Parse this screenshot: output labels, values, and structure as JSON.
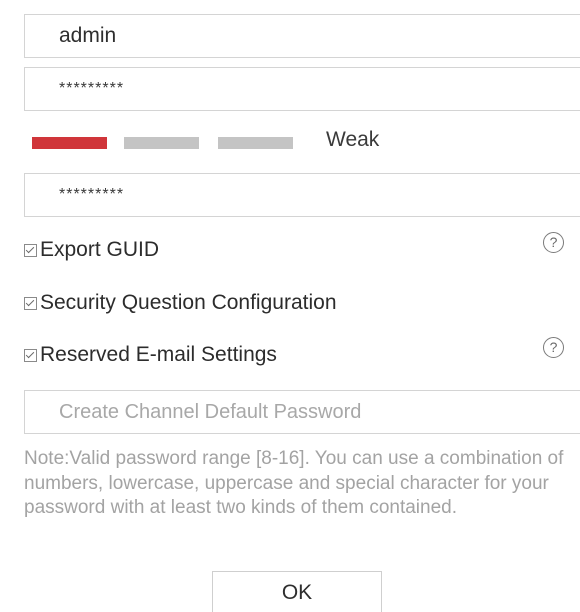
{
  "form": {
    "username_value": "admin",
    "password_value": "*********",
    "password_strength": {
      "label": "Weak",
      "segments_filled": 1,
      "segments_total": 3,
      "colors": {
        "filled": "#d0353a",
        "empty": "#c4c4c4"
      }
    },
    "confirm_password_value": "*********",
    "options": [
      {
        "label": "Export GUID",
        "checked": true,
        "help_icon": "question-circle-icon"
      },
      {
        "label": "Security Question Configuration",
        "checked": true
      },
      {
        "label": "Reserved E-mail Settings",
        "checked": true,
        "help_icon": "question-circle-icon"
      }
    ],
    "help_icon_glyph": "?",
    "channel_password_placeholder": "Create Channel Default Password",
    "note": "Note:Valid password range [8-16]. You can use a combination of numbers, lowercase, uppercase and special character for your password with at least two kinds of them contained.",
    "ok_label": "OK"
  }
}
